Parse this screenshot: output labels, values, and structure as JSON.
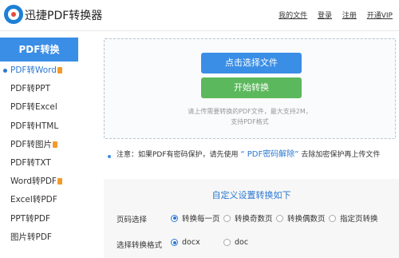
{
  "header": {
    "logo_text": "迅捷PDF转换器",
    "nav": [
      "我的文件",
      "登录",
      "注册",
      "开通VIP"
    ]
  },
  "sidebar": {
    "title": "PDF转换",
    "items": [
      {
        "label": "PDF转Word",
        "active": true,
        "badge": true
      },
      {
        "label": "PDF转PPT",
        "active": false,
        "badge": false
      },
      {
        "label": "PDF转Excel",
        "active": false,
        "badge": false
      },
      {
        "label": "PDF转HTML",
        "active": false,
        "badge": false
      },
      {
        "label": "PDF转图片",
        "active": false,
        "badge": true
      },
      {
        "label": "PDF转TXT",
        "active": false,
        "badge": false
      },
      {
        "label": "Word转PDF",
        "active": false,
        "badge": true
      },
      {
        "label": "Excel转PDF",
        "active": false,
        "badge": false
      },
      {
        "label": "PPT转PDF",
        "active": false,
        "badge": false
      },
      {
        "label": "图片转PDF",
        "active": false,
        "badge": false
      }
    ]
  },
  "upload": {
    "choose_label": "点击选择文件",
    "start_label": "开始转换",
    "hint_line1": "请上传需要转换的PDF文件，最大支持2M，",
    "hint_line2": "支持PDF格式"
  },
  "notice": {
    "prefix": "注意：如果PDF有密码保护，请先使用",
    "link": "“ PDF密码解除”",
    "suffix": "去除加密保护再上传文件"
  },
  "settings": {
    "title": "自定义设置转换如下",
    "page_label": "页码选择",
    "page_options": [
      "转换每一页",
      "转换奇数页",
      "转换偶数页",
      "指定页转换"
    ],
    "page_selected": 0,
    "format_label": "选择转换格式",
    "format_options": [
      "docx",
      "doc"
    ],
    "format_selected": 0
  },
  "colors": {
    "primary": "#3a8ee6",
    "start_button": "#5cb85c",
    "badge": "#f39a2b"
  }
}
